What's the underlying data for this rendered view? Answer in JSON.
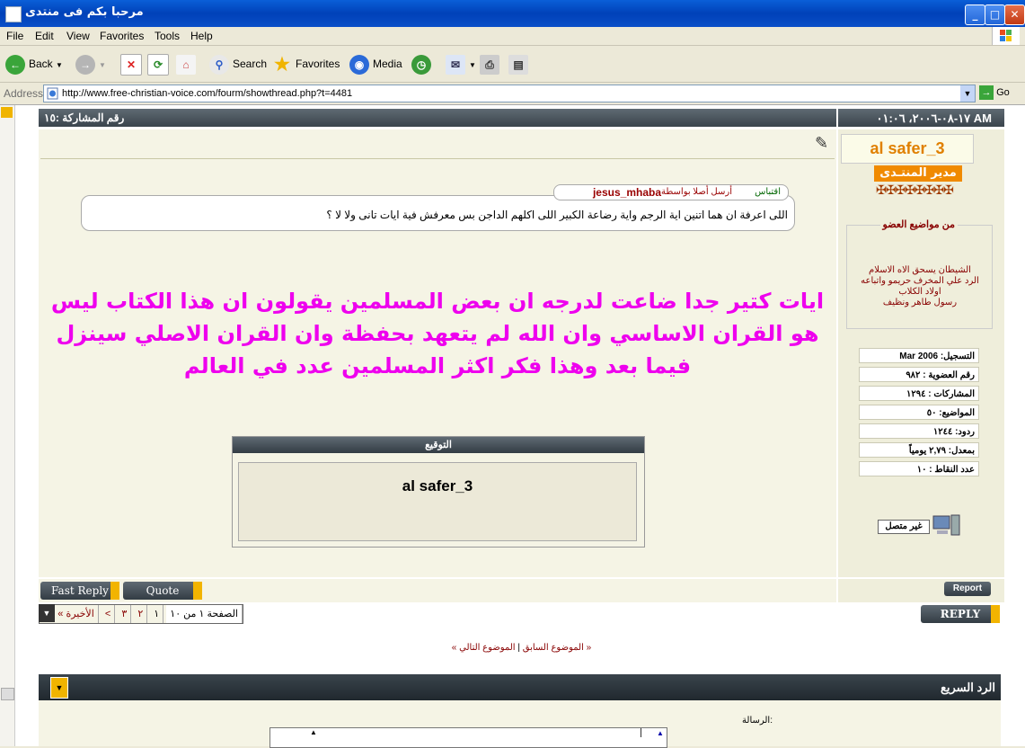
{
  "window": {
    "title": "مرحبا بكم فى منتدى"
  },
  "menu": [
    "File",
    "Edit",
    "View",
    "Favorites",
    "Tools",
    "Help"
  ],
  "toolbar": {
    "back": "Back",
    "search": "Search",
    "favorites": "Favorites",
    "media": "Media"
  },
  "address": {
    "label": "Address",
    "url": "http://www.free-christian-voice.com/fourm/showthread.php?t=4481",
    "go": "Go"
  },
  "post": {
    "number_label": "رقم المشاركة :١٥",
    "datetime": "١٧-٠٨-٢٠٠٦، ٠١:٠٦ AM",
    "quote_label": "اقتباس",
    "quote_by_label": "أرسل أصلا بواسطة",
    "quote_author": "jesus_mhaba",
    "quote_text": "اللى اعرفة ان هما اتنين اية الرجم واية رضاعة الكبير اللى اكلهم الداجن بس معرفش فية ايات تانى ولا لا ؟",
    "body_text": "ايات كتير جدا ضاعت لدرجه ان بعض المسلمين يقولون ان هذا الكتاب ليس هو القران الاساسي وان الله لم يتعهد بحفظة وان القران الاصلي سينزل فيما بعد وهذا فكر اكثر المسلمين عدد في العالم",
    "signature_title": "التوقيع",
    "signature_text": "al safer_3"
  },
  "author": {
    "name": "al safer_3",
    "role_badge": "مدير المنتـدى",
    "topics_title": "من مواضيع العضو",
    "topics": [
      "الشيطان يسحق الاه الاسلام",
      "الرد علي المخرف حريمو واتباعه",
      "اولاد الكلاب",
      "رسول طاهر ونظيف"
    ],
    "stats": [
      "التسجيل: Mar 2006",
      "رقم العضوية : ٩٨٢",
      "المشاركات : ١٢٩٤",
      "المواضيع: ٥٠",
      "ردود: ١٢٤٤",
      "بمعدل: ٢,٧٩ يومياً",
      "عدد النقاط : ١٠"
    ],
    "status": "غير متصل"
  },
  "buttons": {
    "fast_reply": "Fast Reply",
    "quote": "Quote",
    "report": "Report",
    "reply": "REPLY"
  },
  "pager": {
    "label": "الصفحة ١ من ١٠",
    "pages": [
      "١",
      "٢",
      "٣"
    ],
    "next": ">",
    "last": "الأخيرة »"
  },
  "thread_nav": {
    "prev": "« الموضوع السابق",
    "sep": "|",
    "next": "الموضوع التالي »"
  },
  "quick_reply": {
    "title": "الرد السريع",
    "message_label": "الرسالة:"
  }
}
